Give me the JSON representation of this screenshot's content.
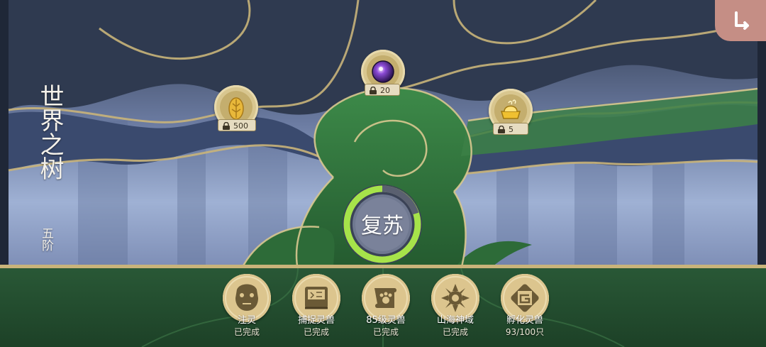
{
  "title": "世界之树",
  "stage": "五阶",
  "revive_label": "复苏",
  "nodes": [
    {
      "name": "golden-seed",
      "icon": "seed-icon",
      "lock_value": "500"
    },
    {
      "name": "purple-orb",
      "icon": "orb-icon",
      "lock_value": "20"
    },
    {
      "name": "golden-treasure",
      "icon": "treasure-icon",
      "lock_value": "5"
    }
  ],
  "tasks": [
    {
      "name": "注灵",
      "status": "已完成",
      "icon": "spirit-mask-icon"
    },
    {
      "name": "捕捉灵兽",
      "status": "已完成",
      "icon": "book-icon"
    },
    {
      "name": "85级灵兽",
      "status": "已完成",
      "icon": "paw-scroll-icon"
    },
    {
      "name": "山海神域",
      "status": "已完成",
      "icon": "sun-emblem-icon"
    },
    {
      "name": "孵化灵兽",
      "status": "93/100只",
      "icon": "spiral-frame-icon"
    }
  ],
  "back_icon": "return-arrow-icon",
  "colors": {
    "leaf_green": "#2f6b3a",
    "sky_blue": "#8da0c8",
    "gold_outline": "#c9b47a",
    "progress_ring": "#a6e34a"
  }
}
